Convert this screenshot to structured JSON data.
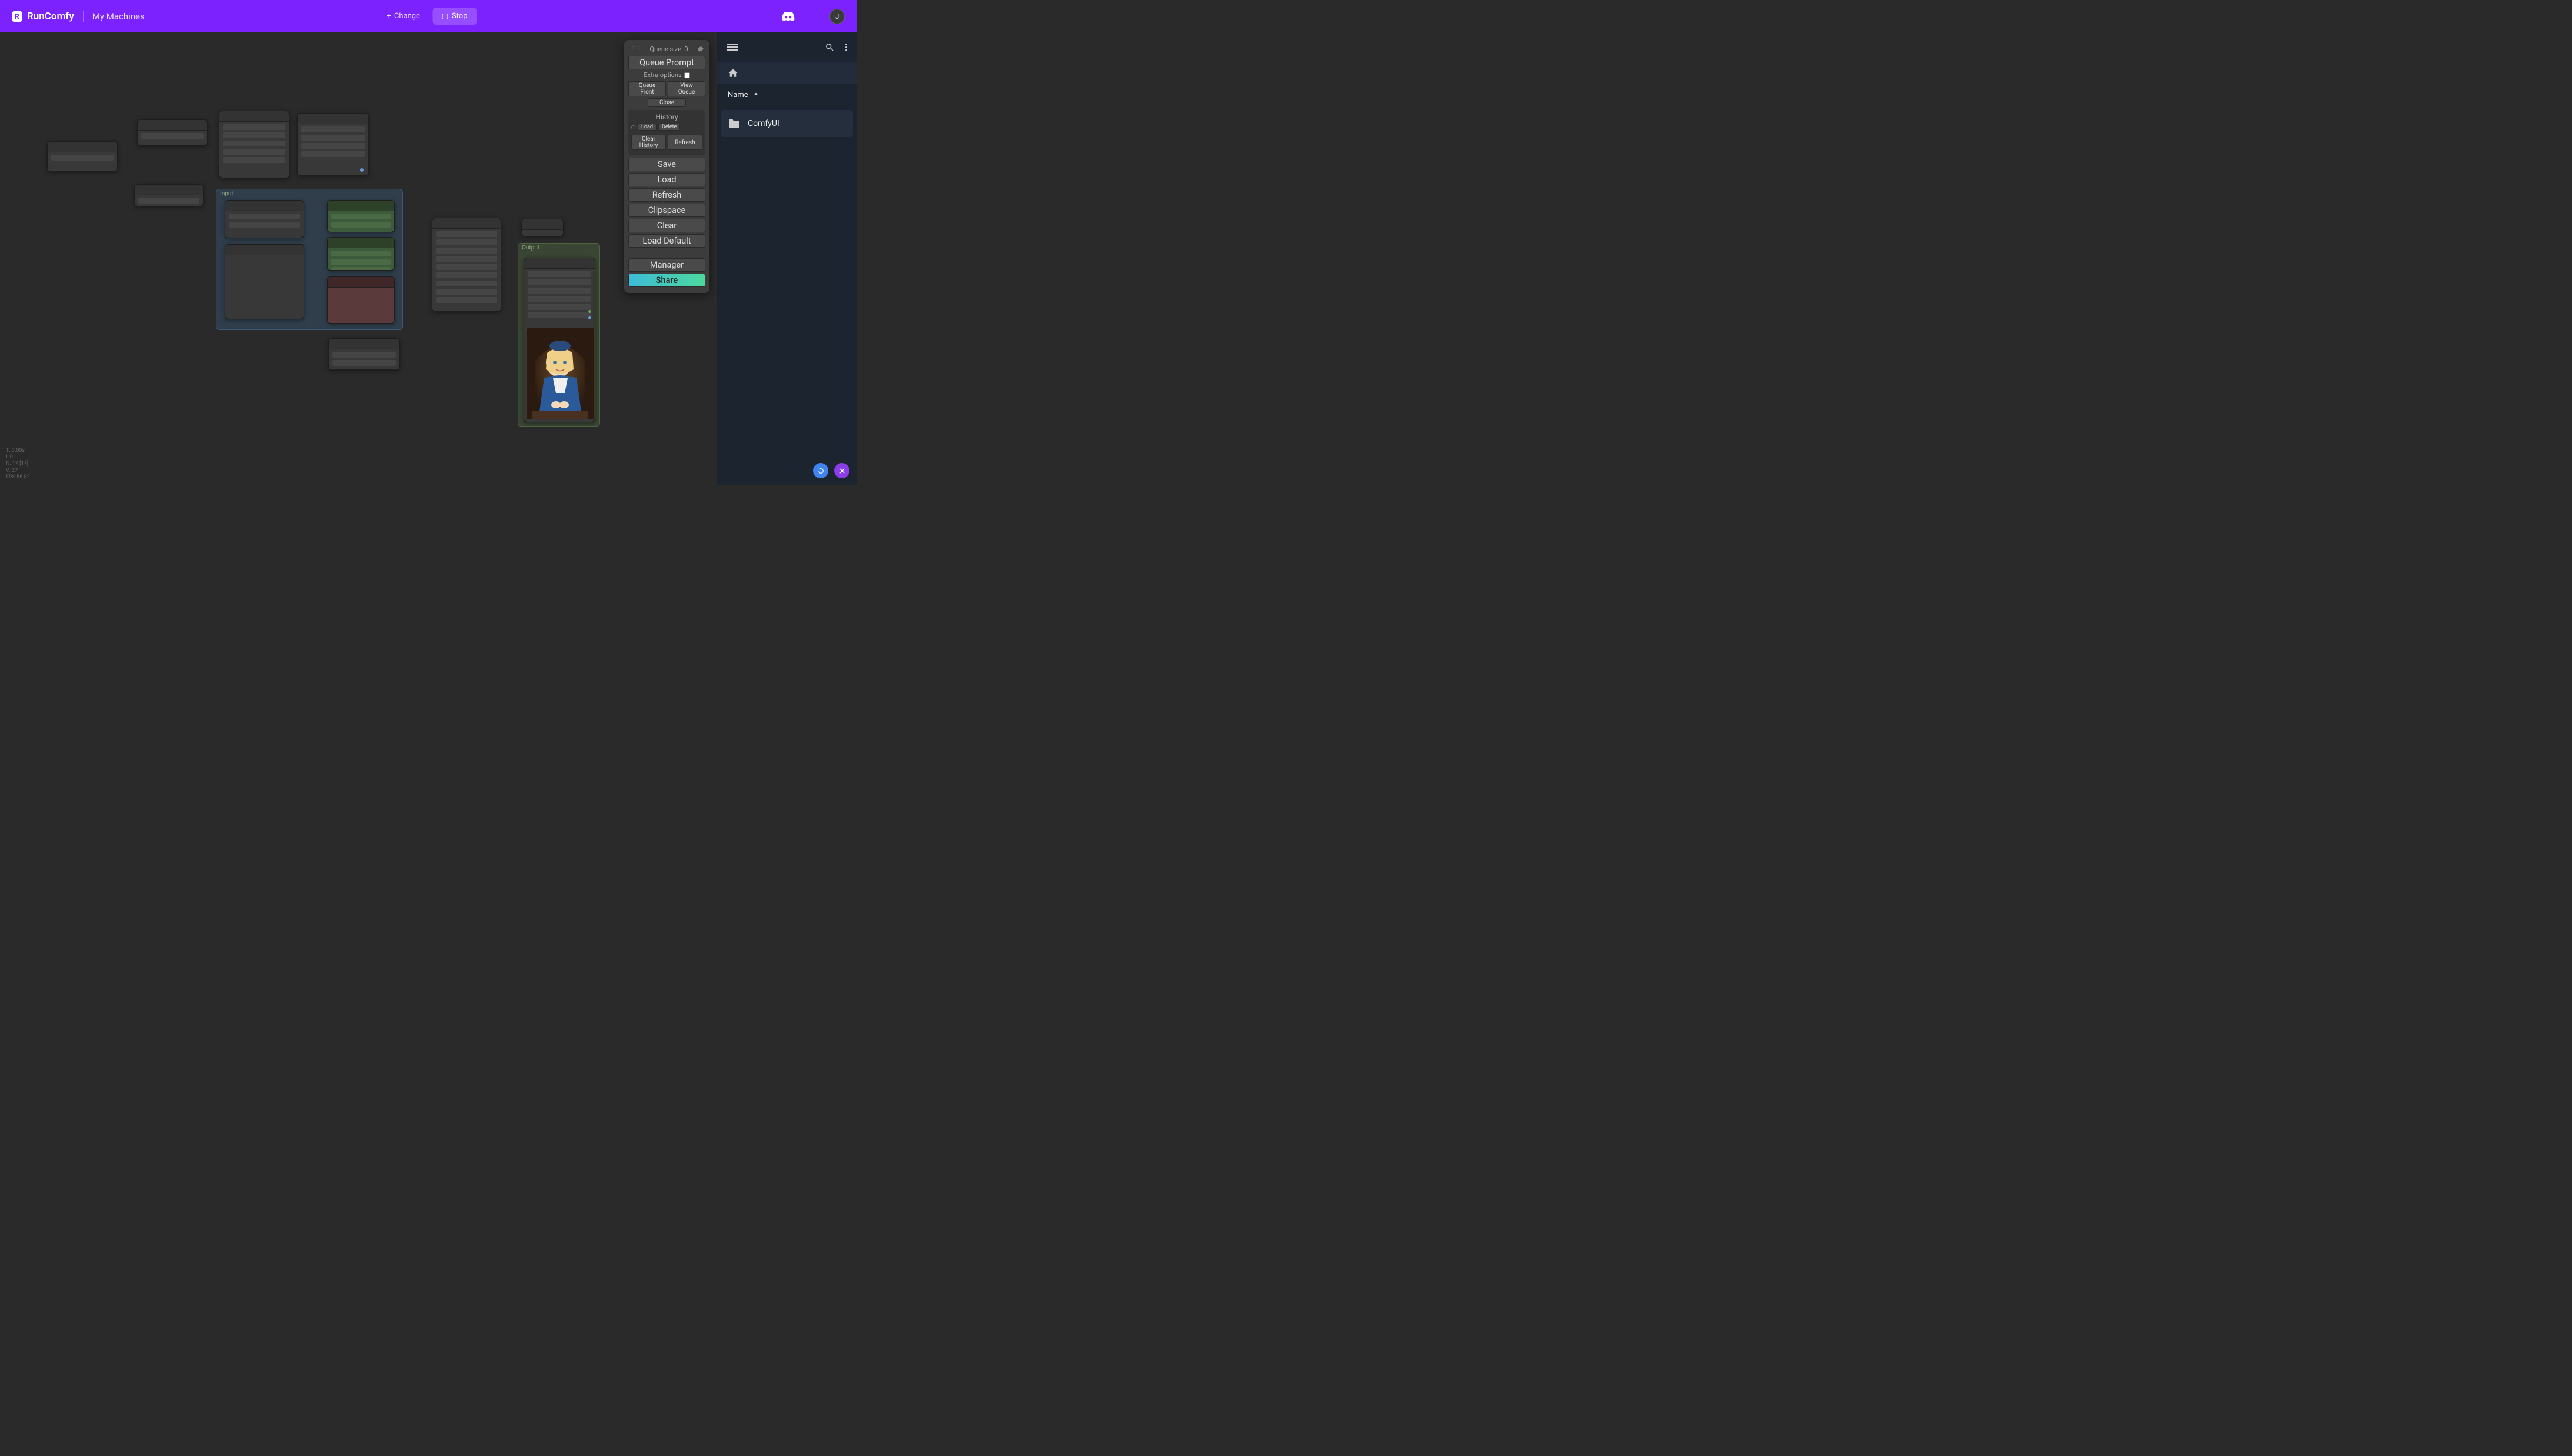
{
  "header": {
    "logo_initial": "R",
    "logo_text": "RunComfy",
    "machines_link": "My Machines",
    "change_label": "Change",
    "stop_label": "Stop",
    "avatar_initial": "J"
  },
  "panel": {
    "queue_size_label": "Queue size: 0",
    "queue_prompt": "Queue Prompt",
    "extra_options": "Extra options",
    "queue_front": "Queue Front",
    "view_queue": "View Queue",
    "close": "Close",
    "history_title": "History",
    "history_index": "0:",
    "history_load": "Load",
    "history_delete": "Delete",
    "clear_history": "Clear History",
    "refresh_btn": "Refresh",
    "save": "Save",
    "load": "Load",
    "refresh": "Refresh",
    "clipspace": "Clipspace",
    "clear": "Clear",
    "load_default": "Load Default",
    "manager": "Manager",
    "share": "Share"
  },
  "groups": {
    "input_label": "Input",
    "output_label": "Output"
  },
  "sidebar": {
    "name_header": "Name",
    "items": [
      {
        "name": "ComfyUI"
      }
    ]
  },
  "stats": {
    "t": "T: 0.00s",
    "i": "I: 0",
    "n": "N: 17 [17]",
    "v": "V: 37",
    "fps": "FPS:56.82"
  },
  "colors": {
    "yellow": "#d8b842",
    "purple": "#a68fd8",
    "orange": "#d88a42",
    "teal": "#4db8a8",
    "pink": "#d868c8",
    "blue": "#6898d8",
    "green": "#6aa050"
  }
}
